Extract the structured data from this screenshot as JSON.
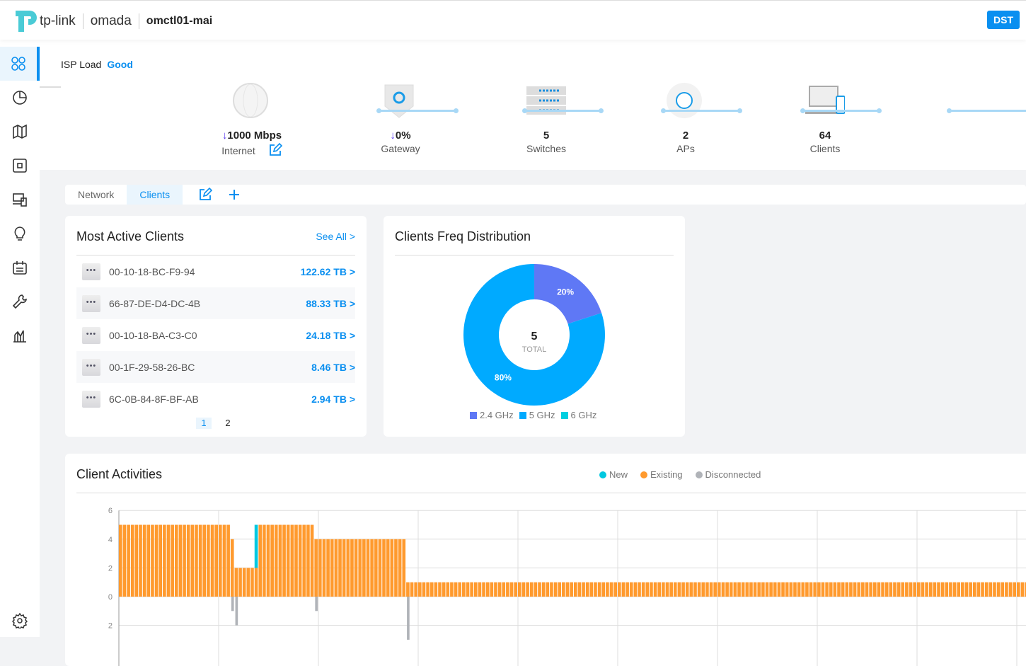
{
  "header": {
    "brand_tplink": "tp-link",
    "brand_omada": "omada",
    "site": "omctl01-mai",
    "badge": "DST"
  },
  "sidebar": {
    "items": [
      "dashboard-icon",
      "statistics-icon",
      "map-icon",
      "devices-icon",
      "clients-icon",
      "insight-icon",
      "logs-icon",
      "tools-icon",
      "reports-icon"
    ],
    "settings": "gear-icon"
  },
  "isp": {
    "label": "ISP Load",
    "status": "Good",
    "nodes": [
      {
        "value": "1000 Mbps",
        "name": "Internet",
        "arrow": true
      },
      {
        "value": "0%",
        "name": "Gateway",
        "arrow": true
      },
      {
        "value": "5",
        "name": "Switches"
      },
      {
        "value": "2",
        "name": "APs"
      },
      {
        "value": "64",
        "name": "Clients"
      }
    ]
  },
  "tabs": [
    {
      "label": "Network"
    },
    {
      "label": "Clients",
      "active": true
    }
  ],
  "active_clients": {
    "title": "Most Active Clients",
    "see_all": "See All >",
    "rows": [
      {
        "mac": "00-10-18-BC-F9-94",
        "usage": "122.62 TB >"
      },
      {
        "mac": "66-87-DE-D4-DC-4B",
        "usage": "88.33 TB >"
      },
      {
        "mac": "00-10-18-BA-C3-C0",
        "usage": "24.18 TB >"
      },
      {
        "mac": "00-1F-29-58-26-BC",
        "usage": "8.46 TB >"
      },
      {
        "mac": "6C-0B-84-8F-BF-AB",
        "usage": "2.94 TB >"
      }
    ],
    "pages": [
      "1",
      "2"
    ],
    "current_page": "1"
  },
  "chart_data": [
    {
      "type": "pie",
      "title": "Clients Freq Distribution",
      "center_value": "5",
      "center_label": "TOTAL",
      "slices": [
        {
          "name": "2.4 GHz",
          "value": 20,
          "label": "20%",
          "color": "#5f78f5"
        },
        {
          "name": "5 GHz",
          "value": 80,
          "label": "80%",
          "color": "#00aaff"
        },
        {
          "name": "6 GHz",
          "value": 0,
          "color": "#00cfe0"
        }
      ],
      "legend": "bottom"
    },
    {
      "type": "bar",
      "title": "Client Activities",
      "legend": "top-right",
      "grid": true,
      "ylim": [
        -2,
        6
      ],
      "yticks": [
        "6",
        "4",
        "2",
        "0",
        "2"
      ],
      "series": [
        {
          "name": "New",
          "color": "#00c8e0",
          "points": [
            {
              "bar": 34,
              "value": 3
            }
          ]
        },
        {
          "name": "Existing",
          "color": "#ff9a2e",
          "values": [
            5,
            5,
            5,
            5,
            5,
            5,
            5,
            5,
            5,
            5,
            5,
            5,
            5,
            5,
            5,
            5,
            5,
            5,
            5,
            5,
            5,
            5,
            5,
            5,
            5,
            5,
            5,
            5,
            4,
            2,
            2,
            2,
            2,
            2,
            2,
            5,
            5,
            5,
            5,
            5,
            5,
            5,
            5,
            5,
            5,
            5,
            5,
            5,
            5,
            4,
            4,
            4,
            4,
            4,
            4,
            4,
            4,
            4,
            4,
            4,
            4,
            4,
            4,
            4,
            4,
            4,
            4,
            4,
            4,
            4,
            4,
            4,
            1,
            1,
            1,
            1,
            1,
            1,
            1,
            1,
            1,
            1,
            1,
            1,
            1,
            1,
            1,
            1,
            1,
            1,
            1,
            1,
            1,
            1,
            1,
            1,
            1,
            1,
            1,
            1,
            1,
            1,
            1,
            1,
            1,
            1,
            1,
            1,
            1,
            1,
            1,
            1,
            1,
            1,
            1,
            1,
            1,
            1,
            1,
            1,
            1,
            1,
            1,
            1,
            1,
            1,
            1,
            1,
            1,
            1,
            1,
            1,
            1,
            1,
            1,
            1,
            1,
            1,
            1,
            1,
            1,
            1,
            1,
            1,
            1,
            1,
            1,
            1,
            1,
            1,
            1,
            1,
            1,
            1,
            1,
            1,
            1,
            1,
            1,
            1,
            1,
            1,
            1,
            1,
            1,
            1,
            1,
            1,
            1,
            1,
            1,
            1,
            1,
            1,
            1,
            1,
            1,
            1,
            1,
            1,
            1,
            1,
            1,
            1,
            1,
            1,
            1,
            1,
            1,
            1,
            1,
            1,
            1,
            1,
            1,
            1,
            1,
            1,
            1,
            1,
            1,
            1,
            1,
            1,
            1,
            1,
            1,
            1,
            1,
            1,
            1,
            1,
            1,
            1,
            1,
            1,
            1,
            1,
            1,
            1,
            1,
            1,
            1,
            1,
            1,
            1,
            1,
            1
          ]
        },
        {
          "name": "Disconnected",
          "color": "#b0b3b8",
          "points": [
            {
              "bar": 28,
              "value": 1
            },
            {
              "bar": 29,
              "value": 2
            },
            {
              "bar": 49,
              "value": 1
            },
            {
              "bar": 72,
              "value": 3
            }
          ]
        }
      ]
    }
  ]
}
